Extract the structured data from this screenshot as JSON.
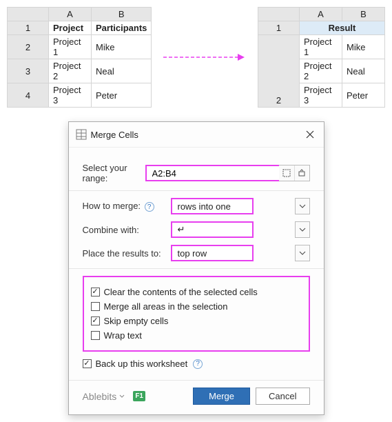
{
  "source_sheet": {
    "columns": [
      "A",
      "B"
    ],
    "rows": [
      {
        "n": "1",
        "a": "Project",
        "b": "Participants",
        "bold": true
      },
      {
        "n": "2",
        "a": "Project 1",
        "b": "Mike"
      },
      {
        "n": "3",
        "a": "Project 2",
        "b": "Neal"
      },
      {
        "n": "4",
        "a": "Project 3",
        "b": "Peter"
      }
    ]
  },
  "result_sheet": {
    "columns": [
      "A",
      "B"
    ],
    "header_row": "1",
    "header_label": "Result",
    "data_row": "2",
    "cells": [
      [
        "Project 1",
        "Mike"
      ],
      [
        "Project 2",
        "Neal"
      ],
      [
        "Project 3",
        "Peter"
      ]
    ]
  },
  "dialog": {
    "title": "Merge Cells",
    "range_label": "Select your range:",
    "range_value": "A2:B4",
    "howto_label": "How to merge:",
    "howto_value": "rows into one",
    "combine_label": "Combine with:",
    "combine_value": "↵",
    "place_label": "Place the results to:",
    "place_value": "top row",
    "checks": {
      "clear": {
        "label": "Clear the contents of the selected cells",
        "checked": true
      },
      "mergeall": {
        "label": "Merge all areas in the selection",
        "checked": false
      },
      "skip": {
        "label": "Skip empty cells",
        "checked": true
      },
      "wrap": {
        "label": "Wrap text",
        "checked": false
      }
    },
    "backup": {
      "label": "Back up this worksheet",
      "checked": true
    },
    "brand": "Ablebits",
    "f1": "F1",
    "merge_btn": "Merge",
    "cancel_btn": "Cancel"
  }
}
